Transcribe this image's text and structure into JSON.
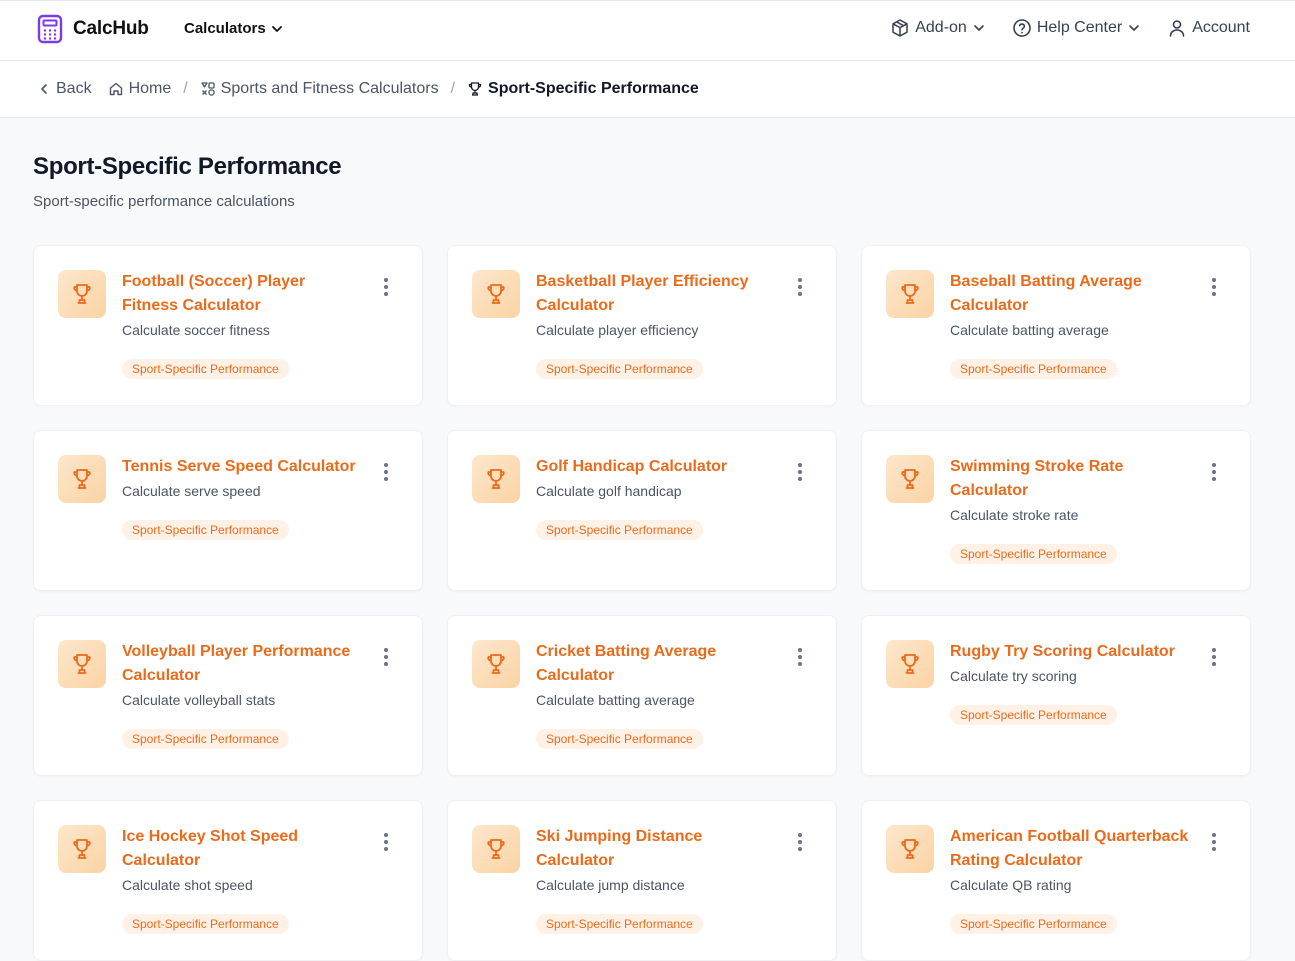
{
  "app": {
    "name": "CalcHub"
  },
  "nav": {
    "calculators": "Calculators",
    "addon": "Add-on",
    "help": "Help Center",
    "account": "Account"
  },
  "breadcrumb": {
    "back": "Back",
    "home": "Home",
    "category": "Sports and Fitness Calculators",
    "current": "Sport-Specific Performance"
  },
  "page": {
    "title": "Sport-Specific Performance",
    "subtitle": "Sport-specific performance calculations"
  },
  "colors": {
    "accent": "#ea6b1b",
    "brand": "#7c3aed"
  },
  "cards": [
    {
      "title": "Football (Soccer) Player Fitness Calculator",
      "desc": "Calculate soccer fitness",
      "tag": "Sport-Specific Performance",
      "icon": "trophy-icon"
    },
    {
      "title": "Basketball Player Efficiency Calculator",
      "desc": "Calculate player efficiency",
      "tag": "Sport-Specific Performance",
      "icon": "trophy-icon"
    },
    {
      "title": "Baseball Batting Average Calculator",
      "desc": "Calculate batting average",
      "tag": "Sport-Specific Performance",
      "icon": "trophy-icon"
    },
    {
      "title": "Tennis Serve Speed Calculator",
      "desc": "Calculate serve speed",
      "tag": "Sport-Specific Performance",
      "icon": "trophy-icon"
    },
    {
      "title": "Golf Handicap Calculator",
      "desc": "Calculate golf handicap",
      "tag": "Sport-Specific Performance",
      "icon": "trophy-icon"
    },
    {
      "title": "Swimming Stroke Rate Calculator",
      "desc": "Calculate stroke rate",
      "tag": "Sport-Specific Performance",
      "icon": "trophy-icon"
    },
    {
      "title": "Volleyball Player Performance Calculator",
      "desc": "Calculate volleyball stats",
      "tag": "Sport-Specific Performance",
      "icon": "trophy-icon"
    },
    {
      "title": "Cricket Batting Average Calculator",
      "desc": "Calculate batting average",
      "tag": "Sport-Specific Performance",
      "icon": "trophy-icon"
    },
    {
      "title": "Rugby Try Scoring Calculator",
      "desc": "Calculate try scoring",
      "tag": "Sport-Specific Performance",
      "icon": "trophy-icon"
    },
    {
      "title": "Ice Hockey Shot Speed Calculator",
      "desc": "Calculate shot speed",
      "tag": "Sport-Specific Performance",
      "icon": "trophy-icon"
    },
    {
      "title": "Ski Jumping Distance Calculator",
      "desc": "Calculate jump distance",
      "tag": "Sport-Specific Performance",
      "icon": "trophy-icon"
    },
    {
      "title": "American Football Quarterback Rating Calculator",
      "desc": "Calculate QB rating",
      "tag": "Sport-Specific Performance",
      "icon": "trophy-icon"
    }
  ]
}
